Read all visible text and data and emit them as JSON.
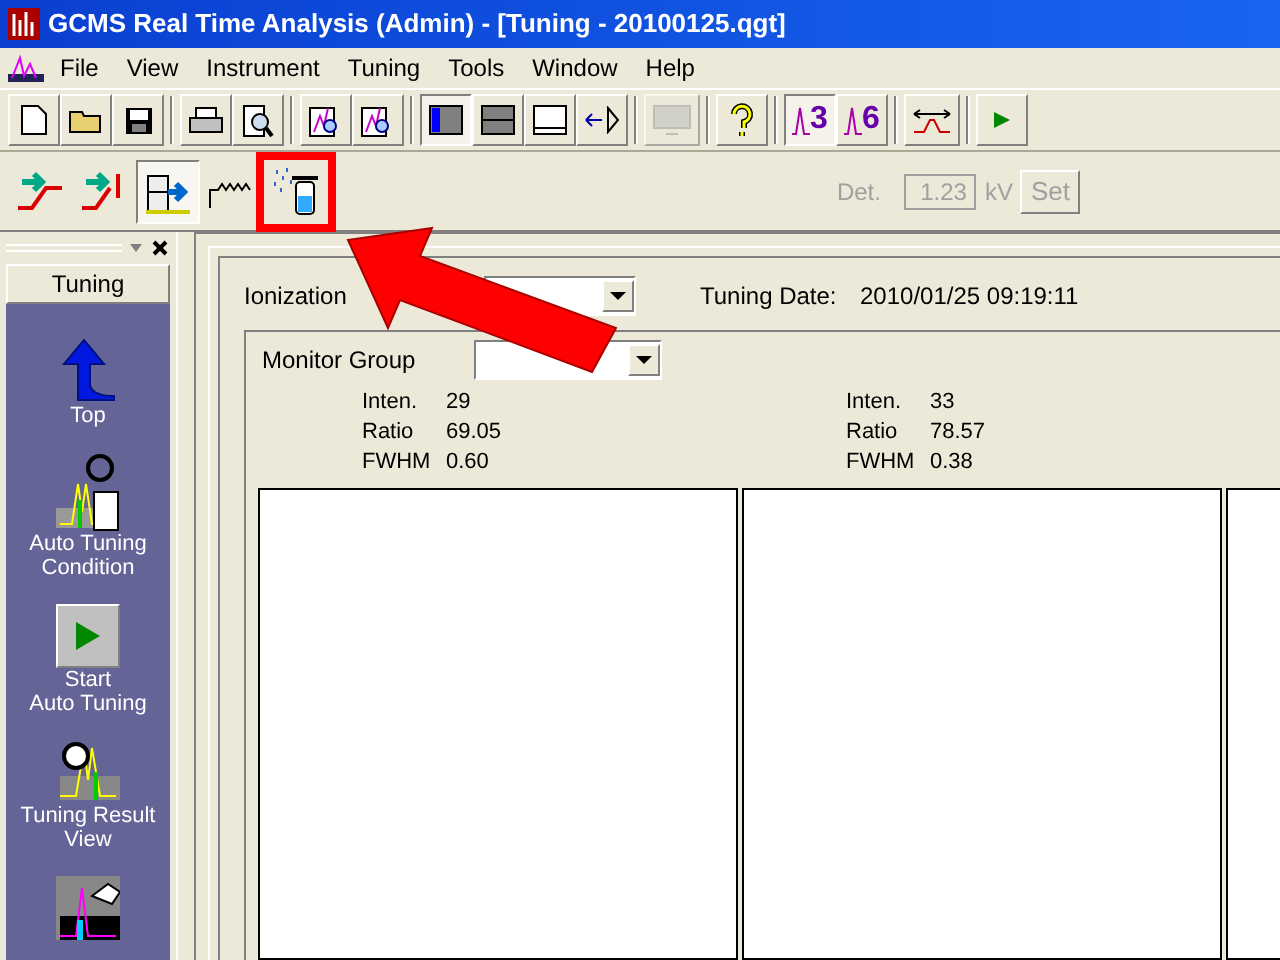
{
  "window": {
    "title": "GCMS Real Time Analysis (Admin) - [Tuning - 20100125.qgt]"
  },
  "menu": [
    "File",
    "View",
    "Instrument",
    "Tuning",
    "Tools",
    "Window",
    "Help"
  ],
  "toolbar": [
    {
      "kind": "new"
    },
    {
      "kind": "open"
    },
    {
      "kind": "save"
    },
    {
      "kind": "sep"
    },
    {
      "kind": "print"
    },
    {
      "kind": "preview"
    },
    {
      "kind": "sep"
    },
    {
      "kind": "chart-search"
    },
    {
      "kind": "chart-search"
    },
    {
      "kind": "sep"
    },
    {
      "kind": "layout-left",
      "pressed": true
    },
    {
      "kind": "layout-split",
      "pressed": false
    },
    {
      "kind": "layout-bottom",
      "pressed": false
    },
    {
      "kind": "arrows",
      "pressed": false
    },
    {
      "kind": "sep"
    },
    {
      "kind": "monitor",
      "disabled": true
    },
    {
      "kind": "sep"
    },
    {
      "kind": "help"
    },
    {
      "kind": "sep"
    },
    {
      "kind": "peak",
      "text": "3",
      "pressed": true
    },
    {
      "kind": "peak",
      "text": "6",
      "pressed": false
    },
    {
      "kind": "sep"
    },
    {
      "kind": "peak-width"
    },
    {
      "kind": "sep"
    },
    {
      "kind": "play"
    }
  ],
  "toolbar2": [
    {
      "kind": "ramp-arrow",
      "pressed": false
    },
    {
      "kind": "stop-arrow",
      "pressed": false
    },
    {
      "kind": "vial-arrow",
      "pressed": true
    },
    {
      "kind": "wave",
      "pressed": false
    },
    {
      "kind": "spray",
      "pressed": false,
      "highlighted": true
    }
  ],
  "detector": {
    "label": "Det.",
    "value": "1.23",
    "unit": "kV",
    "button": "Set",
    "disabled": true
  },
  "sidebar": {
    "title": "Tuning",
    "items": [
      {
        "kind": "up-arrow",
        "label": "Top"
      },
      {
        "kind": "condition",
        "label": "Auto Tuning\nCondition"
      },
      {
        "kind": "start",
        "label": "Start\nAuto Tuning"
      },
      {
        "kind": "result",
        "label": "Tuning Result\nView"
      },
      {
        "kind": "manual"
      }
    ]
  },
  "ionization": {
    "label": "Ionization"
  },
  "tuning_date": {
    "label": "Tuning Date:",
    "value": "2010/01/25 09:19:11"
  },
  "monitor_group": {
    "label": "Monitor Group"
  },
  "readouts": [
    [
      {
        "label": "Inten.",
        "value": "29"
      },
      {
        "label": "Ratio",
        "value": "69.05"
      },
      {
        "label": "FWHM",
        "value": "0.60"
      }
    ],
    [
      {
        "label": "Inten.",
        "value": "33"
      },
      {
        "label": "Ratio",
        "value": "78.57"
      },
      {
        "label": "FWHM",
        "value": "0.38"
      }
    ]
  ]
}
